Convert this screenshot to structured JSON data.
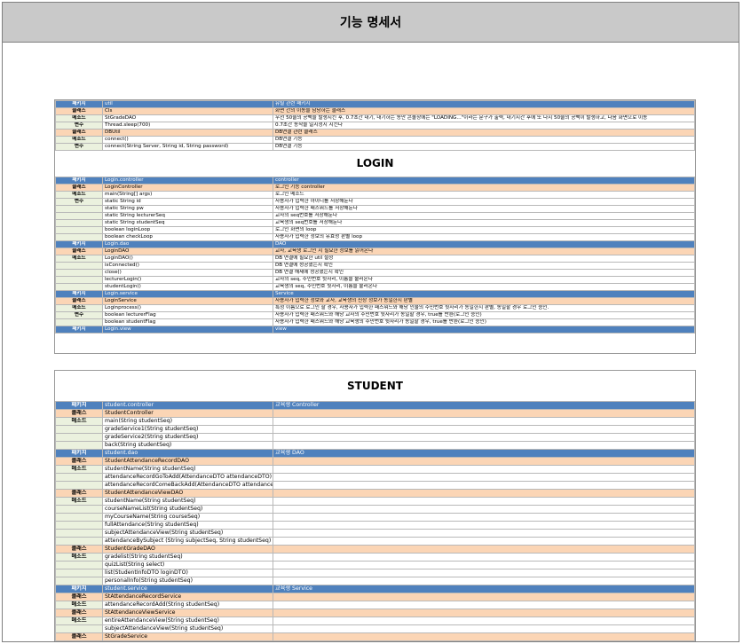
{
  "title": "기능 명세서",
  "util_rows": [
    {
      "type": "pkg",
      "k": "패키지",
      "name": "util",
      "desc": "유틸 관련 패키지"
    },
    {
      "type": "cls",
      "k": "클래스",
      "name": "Cls",
      "desc": "화면 간의 이동을 담당하는 클래스"
    },
    {
      "type": "mth",
      "k": "메소드",
      "name": "StGradeDAO",
      "desc": "우선 50줄의 공백을 발생시킨 후, 0.7초간 대기, 대기하는 동안 콘솔창에는 \"LOADING...\"이라는 문구가 출력, 대기시간 후에 또 다시 50줄의 공백이 발생하고, 다음 화면으로 이동"
    },
    {
      "type": "var",
      "k": "변수",
      "name": "Thread.sleep(700)",
      "desc": "0.7초간 동작을 일시정지 시킨다"
    },
    {
      "type": "cls",
      "k": "클래스",
      "name": "DBUtil",
      "desc": "DB연결 관련 클래스"
    },
    {
      "type": "mth",
      "k": "메소드",
      "name": "connect()",
      "desc": "DB연결 기능"
    },
    {
      "type": "var",
      "k": "변수",
      "name": "connect(String Server, String id, String password)",
      "desc": "DB연결 기능"
    }
  ],
  "login_title": "LOGIN",
  "login_rows": [
    {
      "type": "pkg",
      "k": "패키지",
      "name": "Login.controller",
      "desc": "controller"
    },
    {
      "type": "cls",
      "k": "클래스",
      "name": "LoginController",
      "desc": "로그인 기능 controller"
    },
    {
      "type": "mth",
      "k": "메소드",
      "name": "main(String[] args)",
      "desc": "로그인 메소드"
    },
    {
      "type": "var",
      "k": "변수",
      "name": "static String id",
      "desc": "사용자가 입력한 아이디를 저장해둔다"
    },
    {
      "type": "var",
      "k": "",
      "name": "static String pw",
      "desc": "사용자가 입력한 패스워드를 저장해둔다"
    },
    {
      "type": "var",
      "k": "",
      "name": "static String lecturerSeq",
      "desc": "교사의 seq번호를 저장해둔다"
    },
    {
      "type": "var",
      "k": "",
      "name": "static String studentSeq",
      "desc": "교육생의 seq번호를 저장해둔다"
    },
    {
      "type": "var",
      "k": "",
      "name": "boolean loginLoop",
      "desc": "로그인 화면의 loop"
    },
    {
      "type": "var",
      "k": "",
      "name": "boolean checkLoop",
      "desc": "사용자가 입력한 정보의 유효성 판별 loop"
    },
    {
      "type": "pkg",
      "k": "패키지",
      "name": "Login.dao",
      "desc": "DAO"
    },
    {
      "type": "cls",
      "k": "클래스",
      "name": "LoginDAO",
      "desc": "교사, 교육생 로그인 시 필요한 정보를 읽어온다"
    },
    {
      "type": "mth",
      "k": "메소드",
      "name": "LoginDAO()",
      "desc": "DB 연결에 필요한 util 설정"
    },
    {
      "type": "mth",
      "k": "",
      "name": "isConnected()",
      "desc": "DB 연결에 성공했는지 확인"
    },
    {
      "type": "mth",
      "k": "",
      "name": "close()",
      "desc": "DB 연결 해제에 성공했는지 확인"
    },
    {
      "type": "mth",
      "k": "",
      "name": "lecturerLogin()",
      "desc": "교사의 seq, 주민번호 뒷자리, 이름을 불러온다"
    },
    {
      "type": "mth",
      "k": "",
      "name": "studentLogin()",
      "desc": "교육생의 seq, 주민번호 뒷자리, 이름을 불러온다"
    },
    {
      "type": "pkg",
      "k": "패키지",
      "name": "Login.service",
      "desc": "Service"
    },
    {
      "type": "cls",
      "k": "클래스",
      "name": "LoginService",
      "desc": "사용자가 입력한 정보와 교사, 교육생의 신상 정보가 동일한지 판별"
    },
    {
      "type": "mth",
      "k": "메소드",
      "name": "Loginprocess()",
      "desc": "특정 이름으로 로그인 할 경우, 사용자가 입력한 패스워드와 해당 인물의 주민번호 뒷자리가 동일한지 판별, 동일할 경우 로그인 승인."
    },
    {
      "type": "var",
      "k": "변수",
      "name": "boolean lecturerFlag",
      "desc": "사용자가 입력한 패스워드와 해당 교사의 주민번호 뒷자리가 동일할 경우, true를 반환(로그인 승인)"
    },
    {
      "type": "var",
      "k": "",
      "name": "boolean studentFlag",
      "desc": "사용자가 입력한 패스워드와 해당 교육생의 주민번호 뒷자리가 동일할 경우, true를 반환(로그인 승인)"
    },
    {
      "type": "pkg",
      "k": "패키지",
      "name": "Login.view",
      "desc": "view"
    }
  ],
  "student_title": "STUDENT",
  "student_rows": [
    {
      "type": "pkg",
      "k": "패키지",
      "name": "student.controller",
      "desc": "교육생 Controller"
    },
    {
      "type": "cls",
      "k": "클래스",
      "name": "StudentController",
      "desc": ""
    },
    {
      "type": "mth",
      "k": "메소드",
      "name": "main(String studentSeq)",
      "desc": ""
    },
    {
      "type": "mth",
      "k": "",
      "name": "gradeService1(String studentSeq)",
      "desc": ""
    },
    {
      "type": "mth",
      "k": "",
      "name": "gradeService2(String studentSeq)",
      "desc": ""
    },
    {
      "type": "mth",
      "k": "",
      "name": "back(String studentSeq)",
      "desc": ""
    },
    {
      "type": "pkg",
      "k": "패키지",
      "name": "student.dao",
      "desc": "교육생 DAO"
    },
    {
      "type": "cls",
      "k": "클래스",
      "name": "StudentAttendanceRecordDAO",
      "desc": ""
    },
    {
      "type": "mth",
      "k": "메소드",
      "name": "studentName(String studentSeq)",
      "desc": ""
    },
    {
      "type": "mth",
      "k": "",
      "name": "attendanceRecordGoToAdd(AttendanceDTO attendanceDTO)",
      "desc": ""
    },
    {
      "type": "mth",
      "k": "",
      "name": "attendanceRecordComeBackAdd(AttendanceDTO attendanceDTO)",
      "desc": ""
    },
    {
      "type": "cls",
      "k": "클래스",
      "name": "StudentAttendanceViewDAO",
      "desc": ""
    },
    {
      "type": "mth",
      "k": "메소드",
      "name": "studentName(String studentSeq)",
      "desc": ""
    },
    {
      "type": "mth",
      "k": "",
      "name": "courseNameList(String studentSeq)",
      "desc": ""
    },
    {
      "type": "mth",
      "k": "",
      "name": "myCourseName(String courseSeq)",
      "desc": ""
    },
    {
      "type": "mth",
      "k": "",
      "name": "fullAttendance(String studentSeq)",
      "desc": ""
    },
    {
      "type": "mth",
      "k": "",
      "name": "subjectAttendanceView(String studentSeq)",
      "desc": ""
    },
    {
      "type": "mth",
      "k": "",
      "name": "attendanceBySubject (String subjectSeq, String studentSeq)",
      "desc": ""
    },
    {
      "type": "cls",
      "k": "클래스",
      "name": "StudentGradeDAO",
      "desc": ""
    },
    {
      "type": "mth",
      "k": "메소드",
      "name": "gradelist(String studentSeq)",
      "desc": ""
    },
    {
      "type": "mth",
      "k": "",
      "name": "quizList(String select)",
      "desc": ""
    },
    {
      "type": "mth",
      "k": "",
      "name": "list(StudentInfoDTO loginDTO)",
      "desc": ""
    },
    {
      "type": "mth",
      "k": "",
      "name": "personalInfo(String studentSeq)",
      "desc": ""
    },
    {
      "type": "pkg",
      "k": "패키지",
      "name": "student.service",
      "desc": "교육생 Service"
    },
    {
      "type": "cls",
      "k": "클래스",
      "name": "StAttendanceRecordService",
      "desc": ""
    },
    {
      "type": "mth",
      "k": "메소드",
      "name": "attendanceRecordAdd(String studentSeq)",
      "desc": ""
    },
    {
      "type": "cls",
      "k": "클래스",
      "name": "StAttendanceViewService",
      "desc": ""
    },
    {
      "type": "mth",
      "k": "메소드",
      "name": "entireAttendanceView(String studentSeq)",
      "desc": ""
    },
    {
      "type": "mth",
      "k": "",
      "name": "subjectAttendanceView(String studentSeq)",
      "desc": ""
    },
    {
      "type": "cls",
      "k": "클래스",
      "name": "StGradeService",
      "desc": ""
    }
  ]
}
